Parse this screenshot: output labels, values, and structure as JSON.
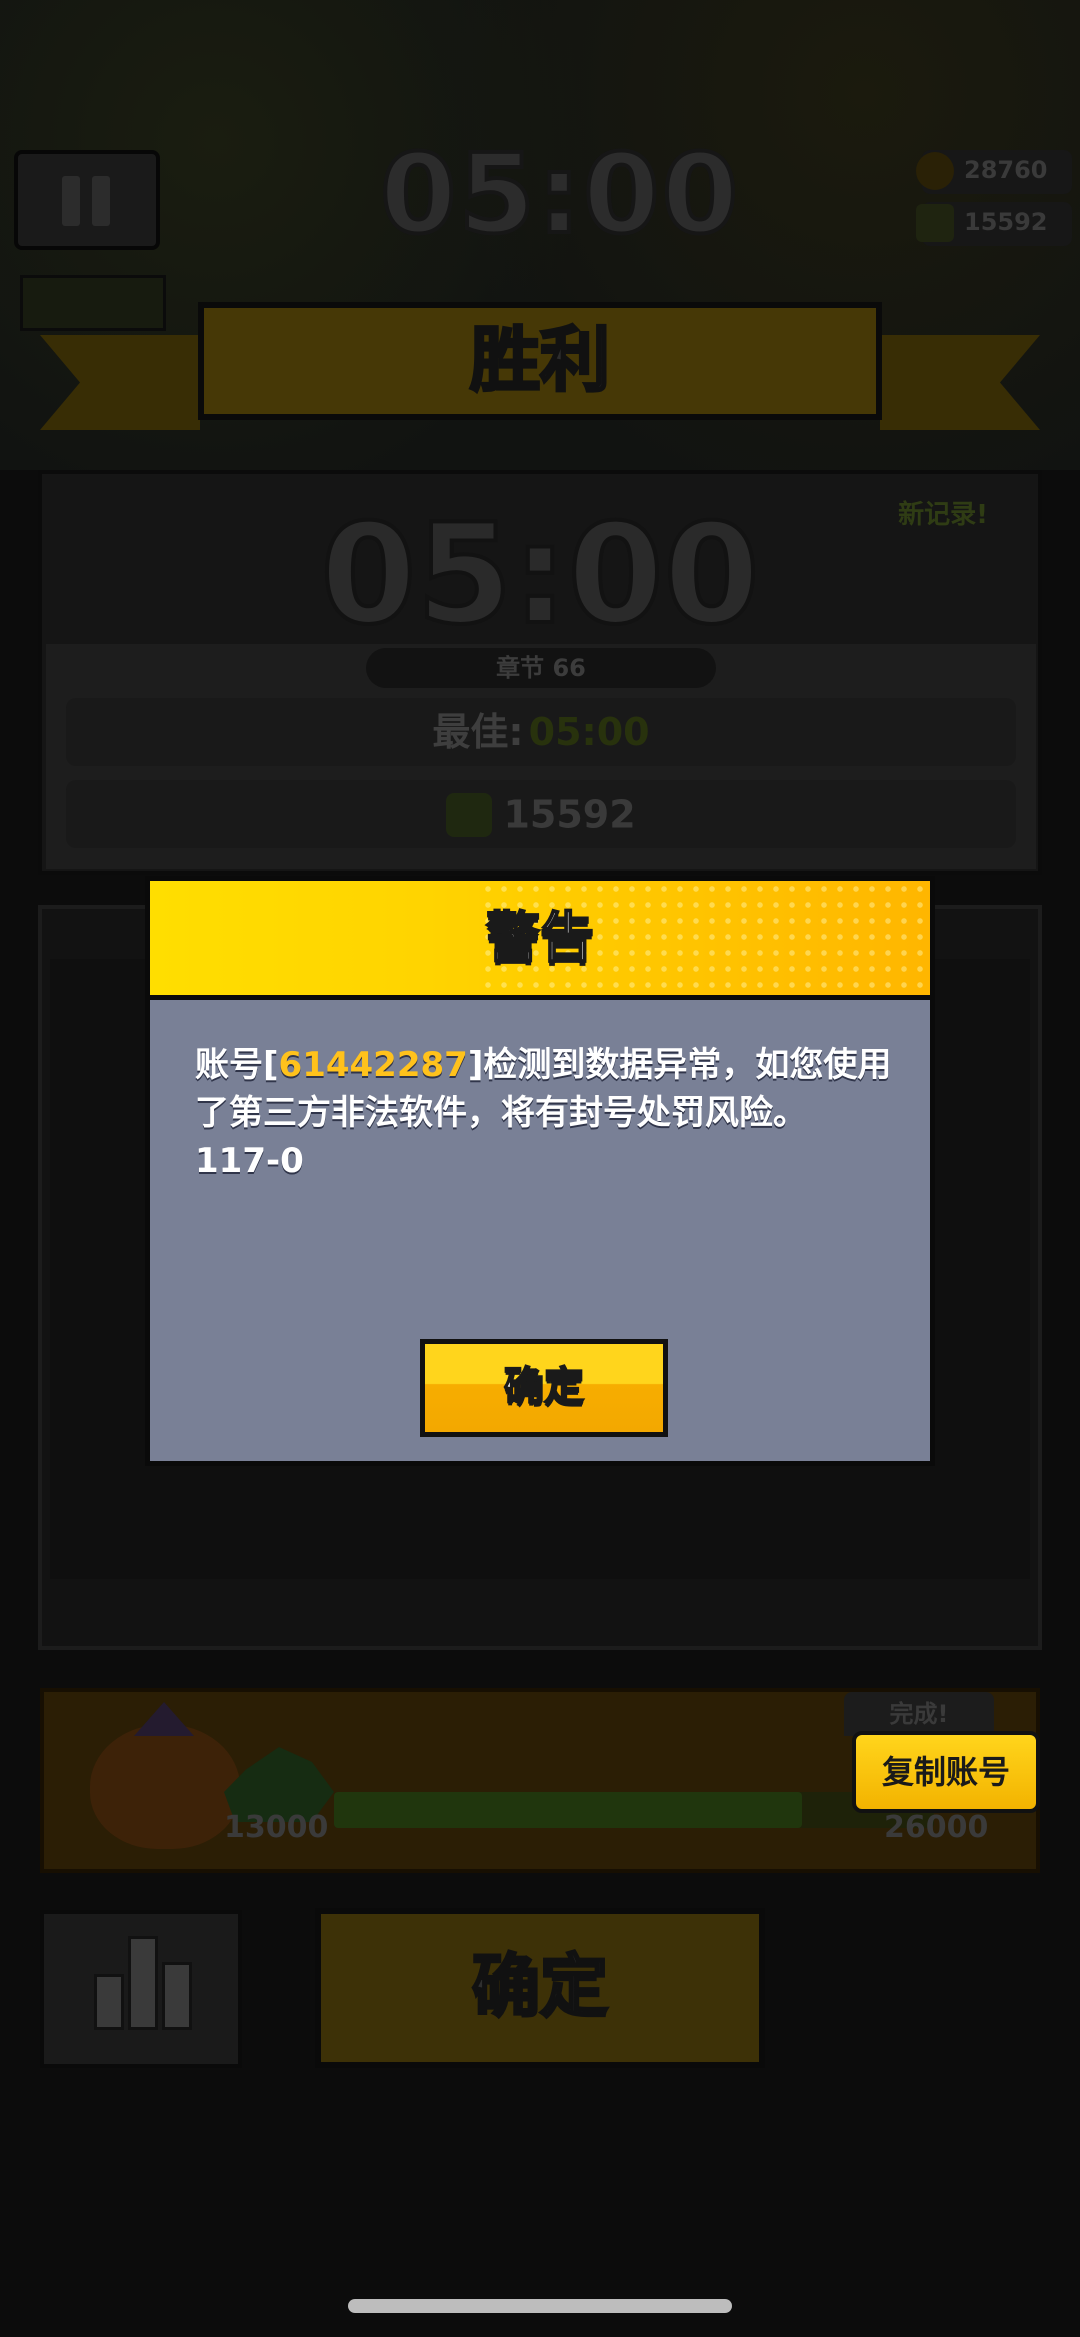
{
  "hud": {
    "timer": "05:00",
    "coins": "28760",
    "gems": "15592"
  },
  "result": {
    "title": "胜利",
    "new_record": "新记录!",
    "time": "05:00",
    "chapter": "章节 66",
    "best_label": "最佳:",
    "best_value": "05:00",
    "gems_earned": "15592"
  },
  "reward": {
    "complete_label": "完成!",
    "progress_start": "13000",
    "progress_end": "26000",
    "progress_fraction": 0.78
  },
  "copy_account_button": "复制账号",
  "bottom_confirm": "确定",
  "dialog": {
    "title": "警告",
    "prefix": "账号[",
    "account_id": "61442287",
    "message": "]检测到数据异常，如您使用了第三方非法软件，将有封号处罚风险。",
    "code": "117-0",
    "confirm": "确定"
  },
  "colors": {
    "dialog_header": "#ffd400",
    "dialog_body": "#798096",
    "account_id": "#ffc21c",
    "button": "#ffd51c"
  }
}
